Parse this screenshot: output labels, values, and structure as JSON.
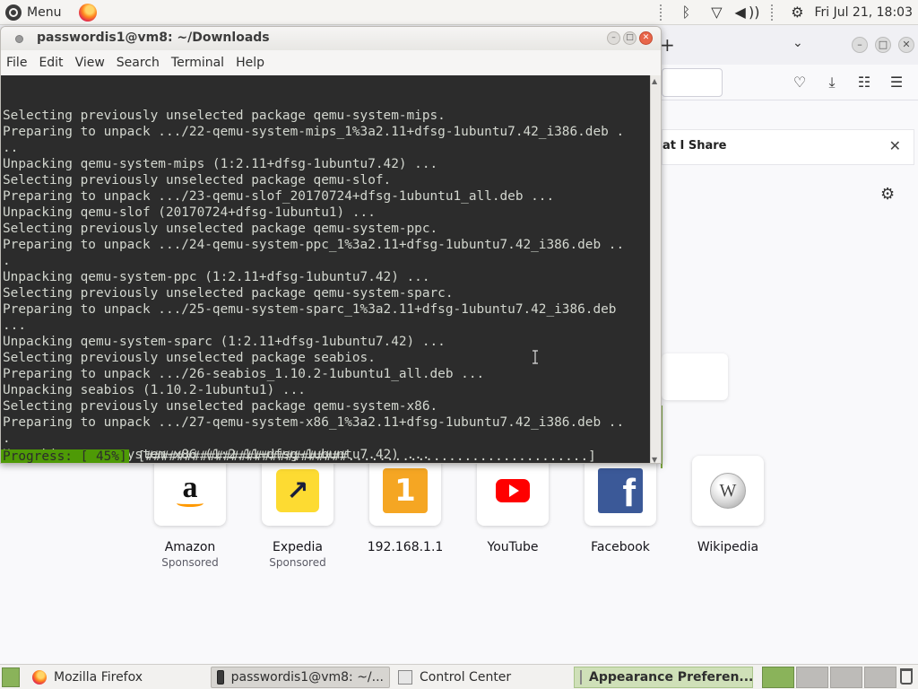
{
  "top_panel": {
    "menu_label": "Menu",
    "clock": "Fri Jul 21, 18:03",
    "tray": {
      "bluetooth": "ᛒ",
      "wifi": "▽",
      "volume": "◀ ))",
      "settings": "⚙"
    }
  },
  "firefox": {
    "newtab_glyph": "+",
    "list_tabs_glyph": "⌵",
    "banner_text": "at I Share",
    "banner_close": "✕",
    "gear_glyph": "⚙",
    "top_sites": [
      {
        "label": "Amazon",
        "sub": "Sponsored",
        "icon": "amazon-icon"
      },
      {
        "label": "Expedia",
        "sub": "Sponsored",
        "icon": "expedia-icon"
      },
      {
        "label": "192.168.1.1",
        "sub": "",
        "icon": "numeric-1-icon"
      },
      {
        "label": "YouTube",
        "sub": "",
        "icon": "youtube-icon"
      },
      {
        "label": "Facebook",
        "sub": "",
        "icon": "facebook-icon"
      },
      {
        "label": "Wikipedia",
        "sub": "",
        "icon": "wikipedia-icon"
      }
    ]
  },
  "terminal": {
    "title": "passwordis1@vm8: ~/Downloads",
    "menu": [
      "File",
      "Edit",
      "View",
      "Search",
      "Terminal",
      "Help"
    ],
    "lines": [
      "Selecting previously unselected package qemu-system-mips.",
      "Preparing to unpack .../22-qemu-system-mips_1%3a2.11+dfsg-1ubuntu7.42_i386.deb .",
      "..",
      "Unpacking qemu-system-mips (1:2.11+dfsg-1ubuntu7.42) ...",
      "Selecting previously unselected package qemu-slof.",
      "Preparing to unpack .../23-qemu-slof_20170724+dfsg-1ubuntu1_all.deb ...",
      "Unpacking qemu-slof (20170724+dfsg-1ubuntu1) ...",
      "Selecting previously unselected package qemu-system-ppc.",
      "Preparing to unpack .../24-qemu-system-ppc_1%3a2.11+dfsg-1ubuntu7.42_i386.deb ..",
      ".",
      "Unpacking qemu-system-ppc (1:2.11+dfsg-1ubuntu7.42) ...",
      "Selecting previously unselected package qemu-system-sparc.",
      "Preparing to unpack .../25-qemu-system-sparc_1%3a2.11+dfsg-1ubuntu7.42_i386.deb",
      "...",
      "Unpacking qemu-system-sparc (1:2.11+dfsg-1ubuntu7.42) ...",
      "Selecting previously unselected package seabios.",
      "Preparing to unpack .../26-seabios_1.10.2-1ubuntu1_all.deb ...",
      "Unpacking seabios (1.10.2-1ubuntu1) ...",
      "Selecting previously unselected package qemu-system-x86.",
      "Preparing to unpack .../27-qemu-system-x86_1%3a2.11+dfsg-1ubuntu7.42_i386.deb ..",
      ".",
      "Unpacking qemu-system-x86 (1:2.11+dfsg-1ubuntu7.42) ..."
    ],
    "progress_label": "Progress: [ 45%]",
    "progress_bar": "[##########################...............................]",
    "progress_percent": 45
  },
  "taskbar": {
    "tasks": [
      {
        "label": "Mozilla Firefox",
        "state": "normal"
      },
      {
        "label": "passwordis1@vm8: ~/...",
        "state": "active"
      },
      {
        "label": "Control Center",
        "state": "normal"
      },
      {
        "label": "Appearance Preferen...",
        "state": "highlight"
      }
    ]
  },
  "colors": {
    "terminal_bg": "#2c2c2c",
    "terminal_fg": "#d3d7cf",
    "progress_green": "#4e9a06",
    "workspace_active": "#8ab35a"
  }
}
